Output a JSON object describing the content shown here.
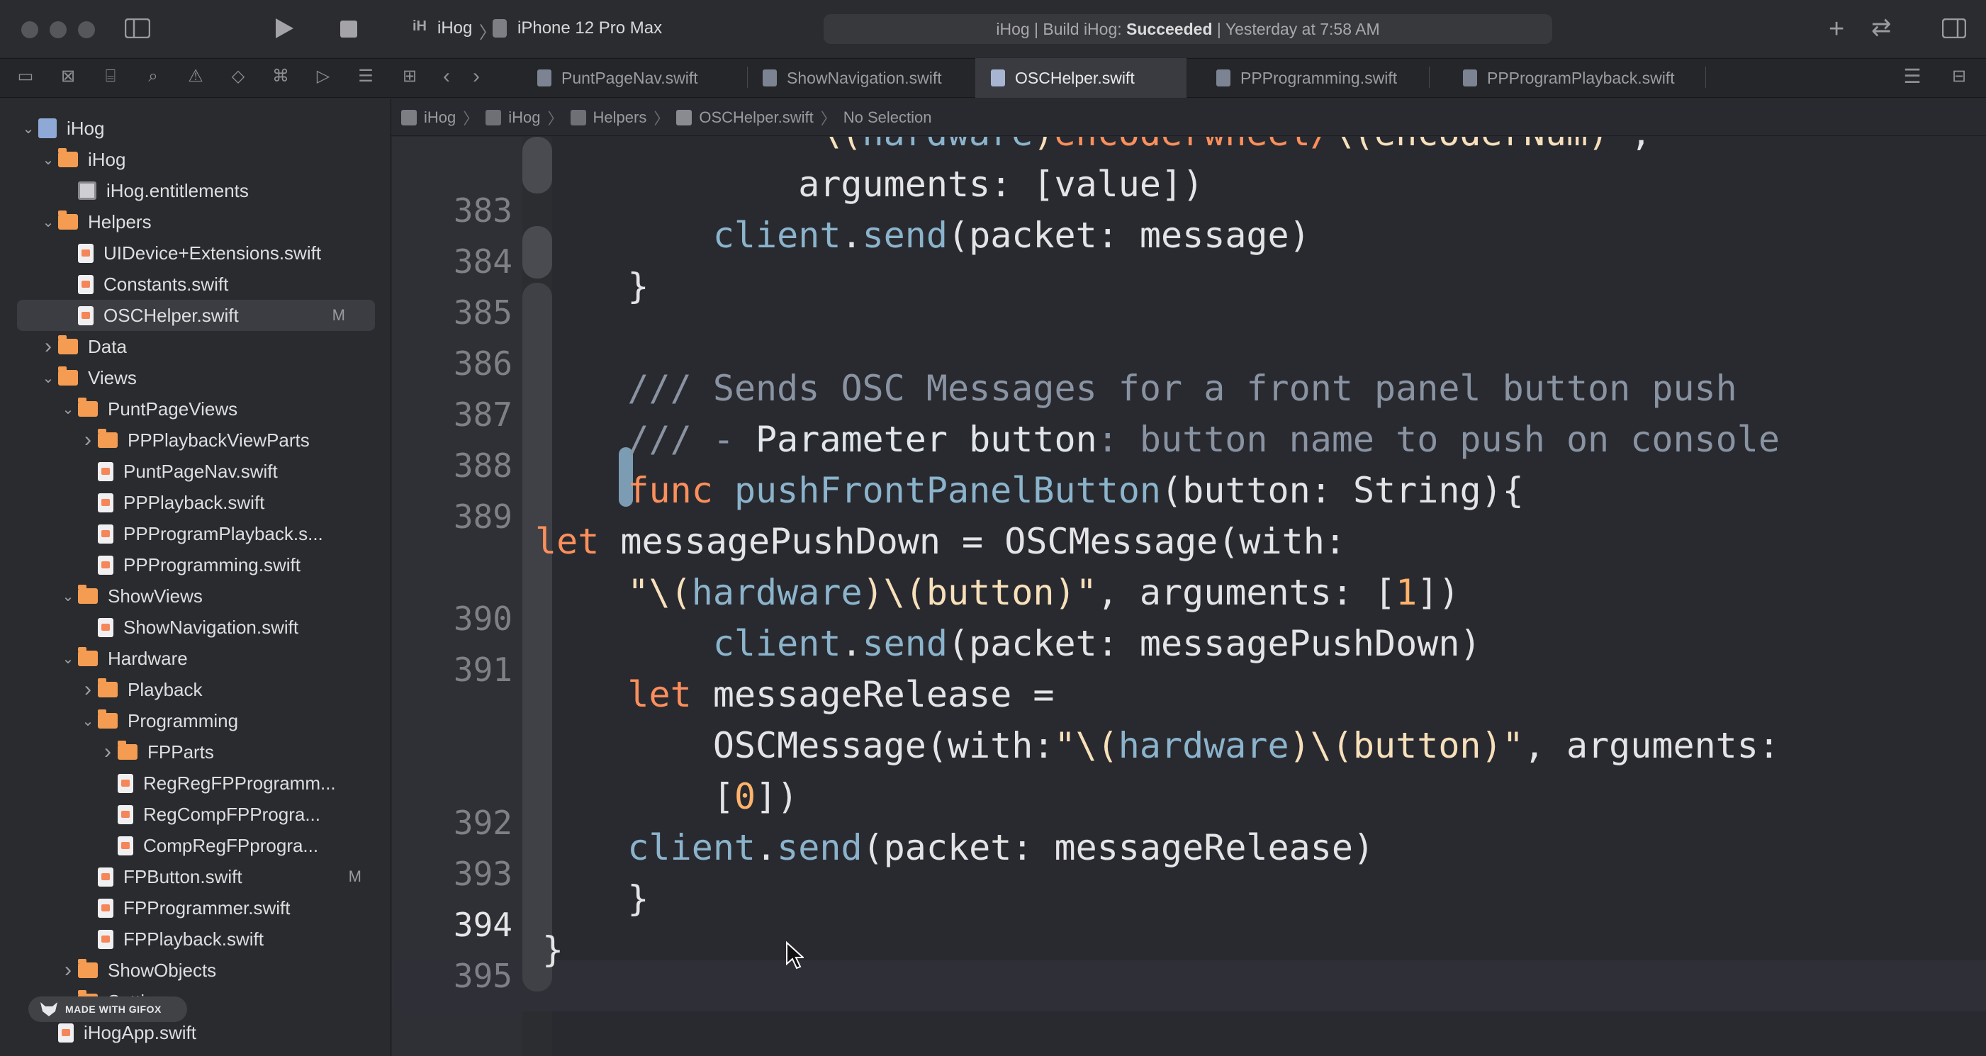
{
  "toolbar": {
    "project_short": "iH",
    "scheme": "iHog",
    "device": "iPhone 12 Pro Max",
    "status_prefix": "iHog | Build iHog: ",
    "status_bold": "Succeeded",
    "status_suffix": " | Yesterday at 7:58 AM"
  },
  "tabs": [
    {
      "label": "PuntPageNav.swift",
      "active": false
    },
    {
      "label": "ShowNavigation.swift",
      "active": false
    },
    {
      "label": "OSCHelper.swift",
      "active": true
    },
    {
      "label": "PPProgramming.swift",
      "active": false
    },
    {
      "label": "PPProgramPlayback.swift",
      "active": false
    }
  ],
  "jumpbar": [
    "iHog",
    "iHog",
    "Helpers",
    "OSCHelper.swift",
    "No Selection"
  ],
  "sidebar": {
    "items": [
      {
        "label": "iHog",
        "icon": "project-icon",
        "disclosure": "open"
      },
      {
        "label": "iHog",
        "icon": "folder-icon",
        "disclosure": "open"
      },
      {
        "label": "iHog.entitlements",
        "icon": "entitlements-icon",
        "disclosure": ""
      },
      {
        "label": "Helpers",
        "icon": "folder-icon",
        "disclosure": "open"
      },
      {
        "label": "UIDevice+Extensions.swift",
        "icon": "swift-file-icon",
        "disclosure": ""
      },
      {
        "label": "Constants.swift",
        "icon": "swift-file-icon",
        "disclosure": ""
      },
      {
        "label": "OSCHelper.swift",
        "icon": "swift-file-icon",
        "disclosure": "",
        "badge": "M",
        "selected": true
      },
      {
        "label": "Data",
        "icon": "folder-icon",
        "disclosure": "closed"
      },
      {
        "label": "Views",
        "icon": "folder-icon",
        "disclosure": "open"
      },
      {
        "label": "PuntPageViews",
        "icon": "folder-icon",
        "disclosure": "open"
      },
      {
        "label": "PPPlaybackViewParts",
        "icon": "folder-icon",
        "disclosure": "closed"
      },
      {
        "label": "PuntPageNav.swift",
        "icon": "swift-file-icon",
        "disclosure": ""
      },
      {
        "label": "PPPlayback.swift",
        "icon": "swift-file-icon",
        "disclosure": ""
      },
      {
        "label": "PPProgramPlayback.s...",
        "icon": "swift-file-icon",
        "disclosure": ""
      },
      {
        "label": "PPProgramming.swift",
        "icon": "swift-file-icon",
        "disclosure": ""
      },
      {
        "label": "ShowViews",
        "icon": "folder-icon",
        "disclosure": "open"
      },
      {
        "label": "ShowNavigation.swift",
        "icon": "swift-file-icon",
        "disclosure": ""
      },
      {
        "label": "Hardware",
        "icon": "folder-icon",
        "disclosure": "open"
      },
      {
        "label": "Playback",
        "icon": "folder-icon",
        "disclosure": "closed"
      },
      {
        "label": "Programming",
        "icon": "folder-icon",
        "disclosure": "open"
      },
      {
        "label": "FPParts",
        "icon": "folder-icon",
        "disclosure": "closed"
      },
      {
        "label": "RegRegFPProgramm...",
        "icon": "swift-file-icon",
        "disclosure": ""
      },
      {
        "label": "RegCompFPProgra...",
        "icon": "swift-file-icon",
        "disclosure": ""
      },
      {
        "label": "CompRegFPprogra...",
        "icon": "swift-file-icon",
        "disclosure": ""
      },
      {
        "label": "FPButton.swift",
        "icon": "swift-file-icon",
        "disclosure": "",
        "badge": "M"
      },
      {
        "label": "FPProgrammer.swift",
        "icon": "swift-file-icon",
        "disclosure": ""
      },
      {
        "label": "FPPlayback.swift",
        "icon": "swift-file-icon",
        "disclosure": ""
      },
      {
        "label": "ShowObjects",
        "icon": "folder-icon",
        "disclosure": "closed"
      },
      {
        "label": "Settings",
        "icon": "folder-icon",
        "disclosure": "closed"
      },
      {
        "label": "iHogApp.swift",
        "icon": "swift-file-icon",
        "disclosure": ""
      }
    ],
    "watermark": "MADE WITH GIFOX"
  },
  "editor": {
    "line_numbers": [
      "383",
      "384",
      "385",
      "386",
      "387",
      "388",
      "389",
      "390",
      "391",
      "392",
      "393",
      "394",
      "395"
    ],
    "current_line": "394"
  },
  "colors": {
    "keyword": "#fc8f5b",
    "function": "#8bb4cc",
    "comment": "#8993a2",
    "string": "#f7e0ba",
    "number": "#ffb36b",
    "change_bar": "#7b9cb3",
    "folder": "#f39c52"
  }
}
